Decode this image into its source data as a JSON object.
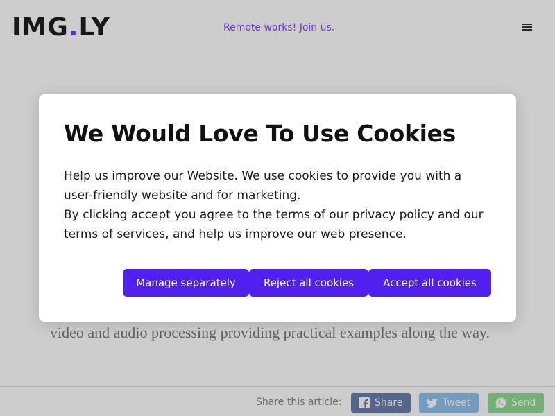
{
  "header": {
    "logo_main": "IMG",
    "logo_dot": ".",
    "logo_suffix": "LY",
    "promo": "Remote works! Join us.",
    "menu_icon": "hamburger-menu-icon"
  },
  "article": {
    "text": "video and audio processing providing practical examples along the way."
  },
  "share": {
    "label": "Share this article:",
    "buttons": [
      {
        "label": "Share",
        "icon": "facebook-icon",
        "color": "#3b5998"
      },
      {
        "label": "Tweet",
        "icon": "twitter-icon",
        "color": "#55acee"
      },
      {
        "label": "Send",
        "icon": "whatsapp-icon",
        "color": "#4dc247"
      }
    ]
  },
  "cookie_modal": {
    "title": "We Would Love To Use Cookies",
    "paragraph1": "Help us improve our Website. We use cookies to provide you with a user-friendly website and for marketing.",
    "paragraph2": "By clicking accept you agree to the terms of our privacy policy and our terms of services, and help us improve our web presence.",
    "buttons": {
      "manage": "Manage separately",
      "reject": "Reject all cookies",
      "accept": "Accept all cookies"
    },
    "button_color": "#5020f0"
  },
  "colors": {
    "brand_purple": "#6b3cff",
    "overlay": "rgba(0,0,0,0.2)"
  }
}
